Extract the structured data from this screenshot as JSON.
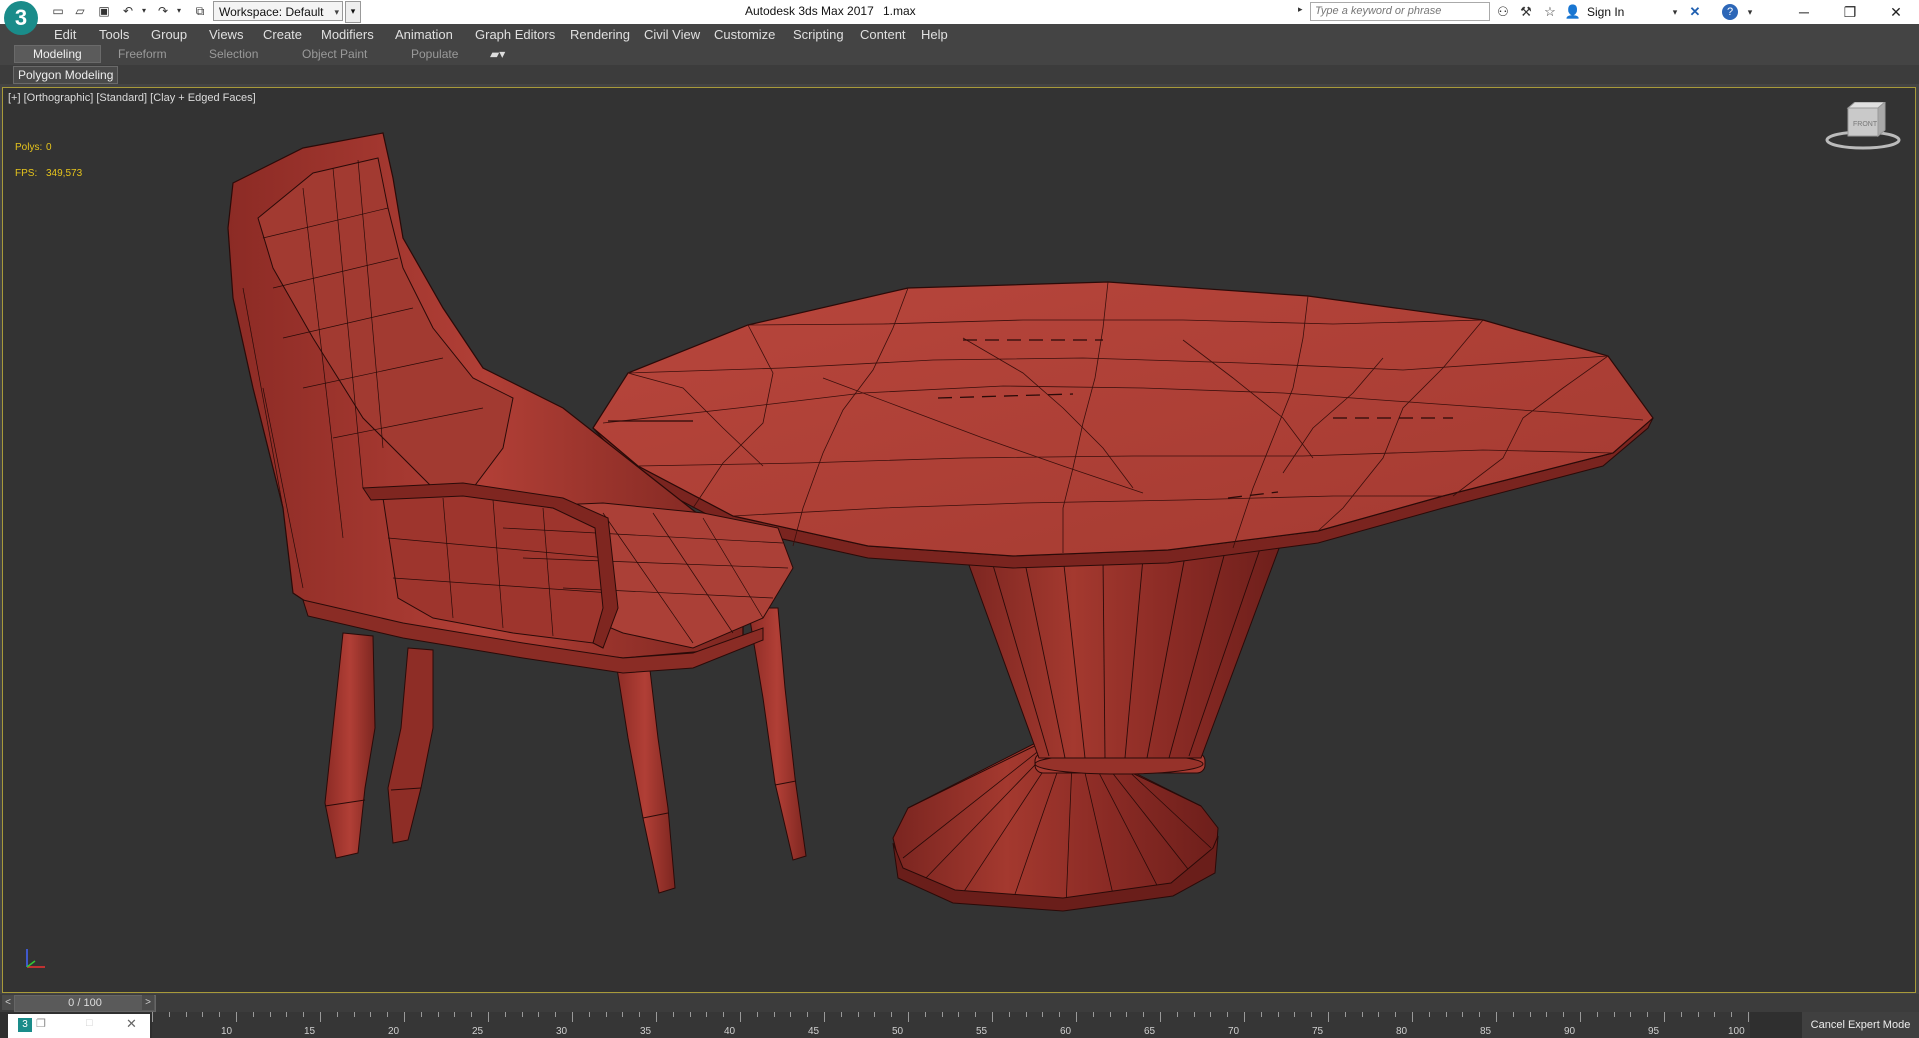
{
  "titlebar": {
    "workspace": "Workspace: Default",
    "app_title": "Autodesk 3ds Max 2017",
    "file_name": "1.max",
    "search_placeholder": "Type a keyword or phrase",
    "sign_in": "Sign In",
    "logo_text": "3"
  },
  "menu": [
    "Edit",
    "Tools",
    "Group",
    "Views",
    "Create",
    "Modifiers",
    "Animation",
    "Graph Editors",
    "Rendering",
    "Civil View",
    "Customize",
    "Scripting",
    "Content",
    "Help"
  ],
  "ribbon": {
    "tabs": [
      "Modeling",
      "Freeform",
      "Selection",
      "Object Paint",
      "Populate"
    ],
    "panel": "Polygon Modeling"
  },
  "viewport": {
    "label": "[+] [Orthographic] [Standard] [Clay + Edged Faces]",
    "stats": {
      "polys_label": "Polys:",
      "polys_value": "0",
      "fps_label": "FPS:",
      "fps_value": "349,573"
    },
    "viewcube_label": "FRONT"
  },
  "timeline": {
    "frame": "0 / 100",
    "ticks": [
      "10",
      "15",
      "20",
      "25",
      "30",
      "35",
      "40",
      "45",
      "50",
      "55",
      "60",
      "65",
      "70",
      "75",
      "80",
      "85",
      "90",
      "95",
      "100"
    ]
  },
  "status": {
    "cancel_expert": "Cancel Expert Mode"
  }
}
